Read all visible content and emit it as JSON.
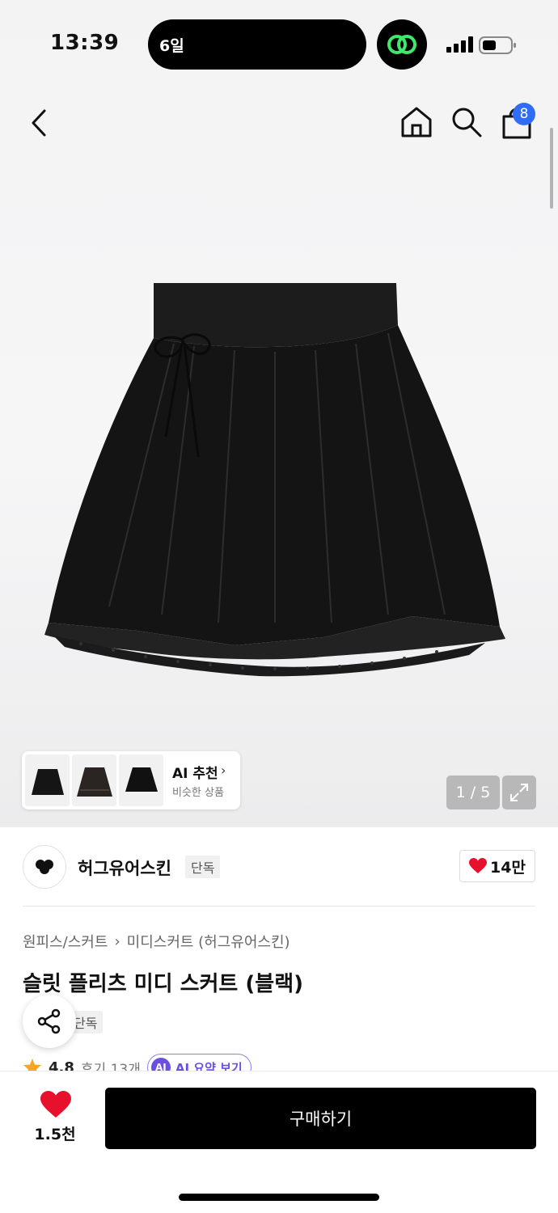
{
  "status_bar": {
    "time": "13:39",
    "island_text": "6일",
    "app_icon": "chain-link-icon",
    "signal_icon": "cellular-signal-icon",
    "battery_icon": "battery-icon"
  },
  "header": {
    "back_icon": "chevron-left-icon",
    "home_icon": "home-icon",
    "search_icon": "search-icon",
    "cart_icon": "shopping-bag-icon",
    "cart_count": "8"
  },
  "gallery": {
    "current": "1 / 5",
    "expand_icon": "expand-icon",
    "ai_card": {
      "title": "AI 추천",
      "subtitle": "비슷한 상품",
      "thumbnail_count": 3
    }
  },
  "brand": {
    "name": "허그유어스킨",
    "exclusive_tag": "단독",
    "likes": "14만"
  },
  "product": {
    "breadcrumb": [
      "원피스/스커트",
      "미디스커트 (허그유어스킨)"
    ],
    "title": "슬릿 플리츠 미디 스커트 (블랙)",
    "tag": "단독",
    "rating": "4.8",
    "reviews": "후기 13개",
    "ai_summary_badge": "AI",
    "ai_summary": "AI 요약 보기"
  },
  "bottom_bar": {
    "wish_count": "1.5천",
    "buy_label": "구매하기"
  },
  "colors": {
    "accent_blue": "#2f6df6",
    "heart_red": "#e8112d",
    "ai_purple": "#6a4fe0",
    "buy_button": "#000000",
    "star": "#f5a623"
  }
}
